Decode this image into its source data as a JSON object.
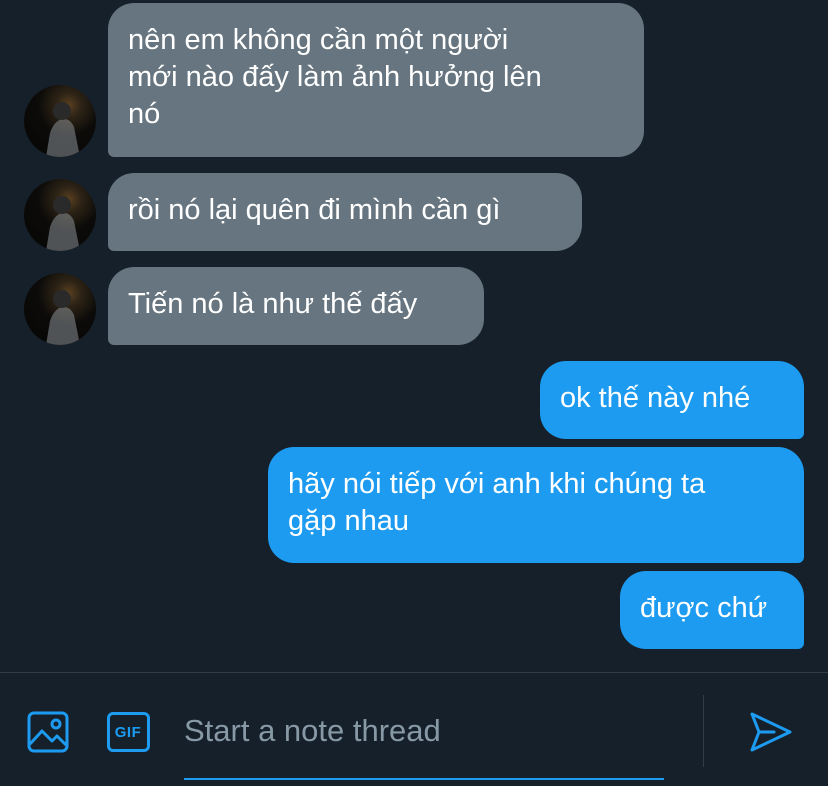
{
  "messages": [
    {
      "direction": "received",
      "text": "nên em không cần một người\nmới nào đấy làm ảnh hưởng lên\nnó",
      "avatar": true
    },
    {
      "direction": "received",
      "text": "rồi nó lại quên đi mình cần gì",
      "avatar": true
    },
    {
      "direction": "received",
      "text": "Tiến nó là như thế đấy",
      "avatar": true
    },
    {
      "direction": "sent",
      "text": "ok thế này nhé"
    },
    {
      "direction": "sent",
      "text": "hãy nói tiếp với anh khi chúng ta\ngặp nhau"
    },
    {
      "direction": "sent",
      "text": "được chứ"
    }
  ],
  "composer": {
    "placeholder": "Start a note thread",
    "gif_label": "GIF",
    "media_icon": "image-icon",
    "send_icon": "send-icon"
  },
  "colors": {
    "background": "#15202b",
    "received_bubble": "#66757f",
    "sent_bubble": "#1d9bf0",
    "accent": "#1d9bf0",
    "placeholder": "#8899a6"
  }
}
